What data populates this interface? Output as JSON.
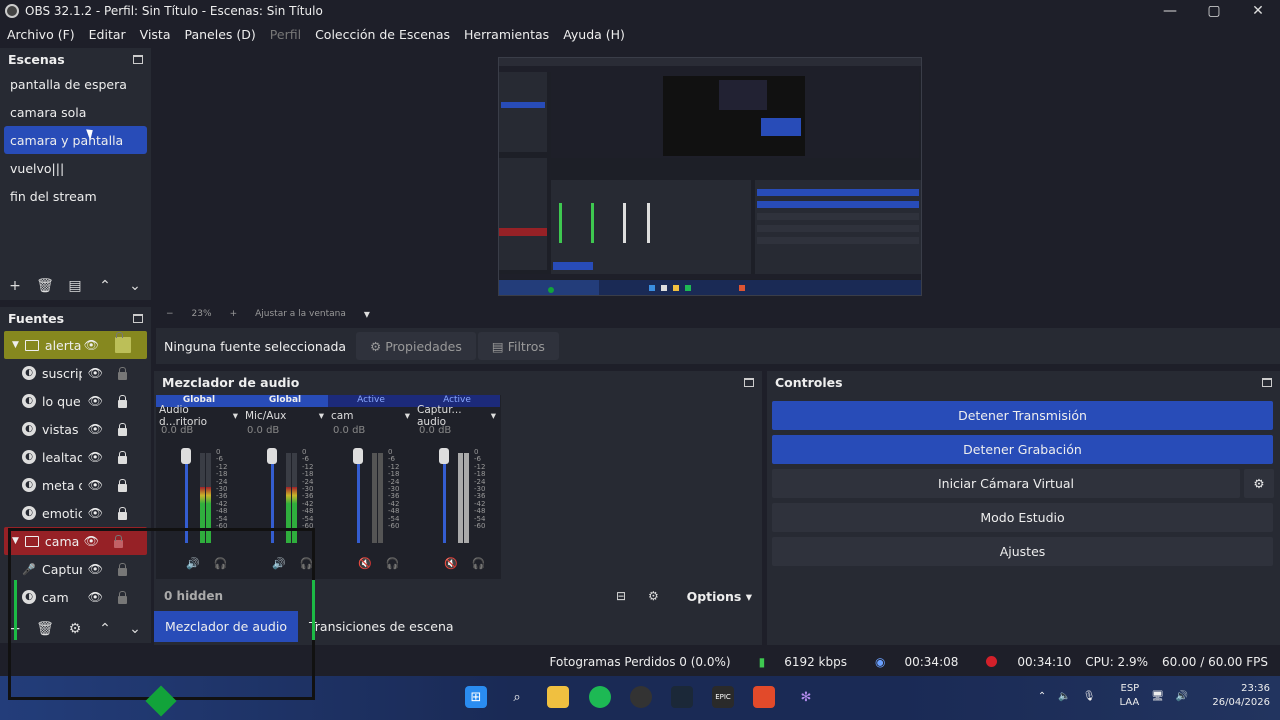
{
  "window": {
    "title": "OBS 32.1.2 - Perfil: Sin Título - Escenas: Sin Título",
    "minimize": "—",
    "maximize": "▢",
    "close": "✕"
  },
  "menu": [
    "Archivo (F)",
    "Editar",
    "Vista",
    "Paneles (D)",
    "Perfil",
    "Colección de Escenas",
    "Herramientas",
    "Ayuda (H)"
  ],
  "scenes": {
    "title": "Escenas",
    "items": [
      "pantalla de espera",
      "camara sola",
      "camara y pantalla",
      "vuelvo|||",
      "fin del stream"
    ],
    "selected_index": 2,
    "toolbar": [
      "+",
      "🗑",
      "▤",
      "⌃",
      "⌄"
    ]
  },
  "preview": {
    "zoom": "23%",
    "fit_label": "Ajustar a la ventana",
    "zoom_minus": "−",
    "zoom_plus": "+",
    "dropdown": "▾",
    "inner_text": "Detener Transmisión",
    "inner_text2": "Detener Grabación"
  },
  "sources": {
    "title": "Fuentes",
    "items": [
      {
        "name": "alerta",
        "type": "group",
        "color": "#86881f"
      },
      {
        "name": "suscrip",
        "type": "browser"
      },
      {
        "name": "lo que q",
        "type": "browser"
      },
      {
        "name": "vistas",
        "type": "browser"
      },
      {
        "name": "lealtad",
        "type": "browser"
      },
      {
        "name": "meta d",
        "type": "browser"
      },
      {
        "name": "emotic",
        "type": "browser"
      },
      {
        "name": "cama",
        "type": "group",
        "color": "#962126"
      },
      {
        "name": "Captur",
        "type": "mic"
      },
      {
        "name": "cam",
        "type": "browser"
      }
    ],
    "toolbar": [
      "+",
      "🗑",
      "⚙",
      "⌃",
      "⌄"
    ]
  },
  "properties_bar": {
    "no_selection": "Ninguna fuente seleccionada",
    "properties": "Propiedades",
    "filters": "Filtros"
  },
  "mixer": {
    "title": "Mezclador de audio",
    "channels": [
      {
        "header": "Global",
        "header_type": "global",
        "name": "Audio d...ritorio",
        "db": "0.0 dB",
        "level": 0.62
      },
      {
        "header": "Global",
        "header_type": "global",
        "name": "Mic/Aux",
        "db": "0.0 dB",
        "level": 0.62
      },
      {
        "header": "Active",
        "header_type": "active",
        "name": "cam",
        "db": "0.0 dB",
        "level": 0.0
      },
      {
        "header": "Active",
        "header_type": "active",
        "name": "Captur... audio",
        "db": "0.0 dB",
        "level": 0.0
      }
    ],
    "scale": [
      "0",
      "-6",
      "-12",
      "-18",
      "-24",
      "-30",
      "-36",
      "-42",
      "-48",
      "-54",
      "-60"
    ],
    "hidden": "0 hidden",
    "options": "Options"
  },
  "tabs": [
    "Mezclador de audio",
    "Transiciones de escena"
  ],
  "controls": {
    "title": "Controles",
    "buttons": [
      "Detener Transmisión",
      "Detener Grabación",
      "Iniciar Cámara Virtual",
      "Modo Estudio",
      "Ajustes"
    ]
  },
  "status": {
    "dropped": "Fotogramas Perdidos 0 (0.0%)",
    "kbps": "6192 kbps",
    "stream_time": "00:34:08",
    "rec_time": "00:34:10",
    "cpu": "CPU: 2.9%",
    "fps": "60.00 / 60.00 FPS"
  },
  "taskbar": {
    "lang": "ESP",
    "lang2": "LAA",
    "time": "23:36",
    "date": "26/04/2026"
  }
}
